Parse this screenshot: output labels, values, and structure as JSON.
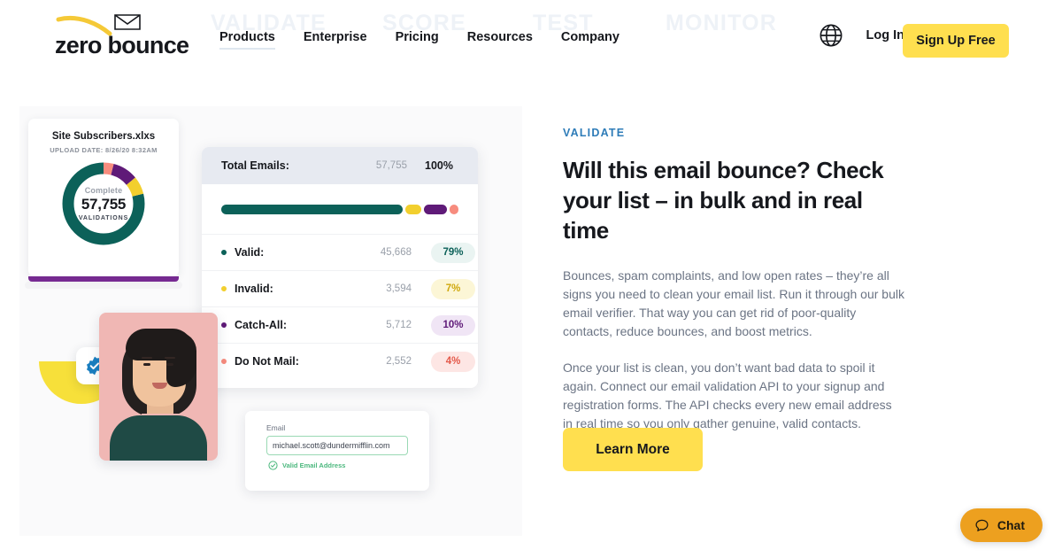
{
  "watermarks": [
    "VALIDATE",
    "SCORE",
    "TEST",
    "MONITOR"
  ],
  "header": {
    "logo_text": "zero bounce",
    "nav": [
      {
        "label": "Products",
        "active": true
      },
      {
        "label": "Enterprise",
        "active": false
      },
      {
        "label": "Pricing",
        "active": false
      },
      {
        "label": "Resources",
        "active": false
      },
      {
        "label": "Company",
        "active": false
      }
    ],
    "language_icon": "globe-icon",
    "login_label": "Log In",
    "signup_label": "Sign Up Free"
  },
  "donut_card": {
    "title": "Site Subscribers.xlxs",
    "subtitle": "UPLOAD DATE: 8/26/20 8:32AM",
    "center_top": "Complete",
    "center_count": "57,755",
    "center_bottom": "VALIDATIONS"
  },
  "stats": {
    "header": {
      "label": "Total Emails:",
      "count": "57,755",
      "percent": "100%"
    },
    "rows": [
      {
        "label": "Valid:",
        "count": "45,668",
        "percent": "79%",
        "color": "#0c6159",
        "pill_bg": "#eaf4f2",
        "pill_fg": "#0c6159"
      },
      {
        "label": "Invalid:",
        "count": "3,594",
        "percent": "7%",
        "color": "#f2cf2e",
        "pill_bg": "#fcf6d6",
        "pill_fg": "#cfa80c"
      },
      {
        "label": "Catch-All:",
        "count": "5,712",
        "percent": "10%",
        "color": "#5f1a78",
        "pill_bg": "#f0e5f5",
        "pill_fg": "#5f1a78"
      },
      {
        "label": "Do Not Mail:",
        "count": "2,552",
        "percent": "4%",
        "color": "#f78c7e",
        "pill_bg": "#fde6e4",
        "pill_fg": "#e4594a"
      }
    ]
  },
  "email_card": {
    "field_label": "Email",
    "value": "michael.scott@dundermifflin.com",
    "status_text": "Valid Email Address",
    "status_icon": "check-circle-icon"
  },
  "badge": {
    "icon": "verified-check-icon",
    "color": "#1a7fc1"
  },
  "copy": {
    "eyebrow": "VALIDATE",
    "headline": "Will this email bounce? Check your list – in bulk and in real time",
    "paragraph_1": "Bounces, spam complaints, and low open rates – they’re all signs you need to clean your email list. Run it through our bulk email verifier. That way you can get rid of poor-quality contacts, reduce bounces, and boost metrics.",
    "paragraph_2": "Once your list is clean, you don’t want bad data to spoil it again. Connect our email validation API to your signup and registration forms. The API checks every new email address in real time so you only gather genuine, valid contacts.",
    "cta_label": "Learn More"
  },
  "chat": {
    "label": "Chat",
    "icon": "chat-bubble-icon",
    "color": "#eda01f"
  },
  "chart_data": {
    "type": "pie",
    "title": "Site Subscribers.xlxs",
    "total": 57755,
    "categories": [
      "Valid",
      "Invalid",
      "Catch-All",
      "Do Not Mail"
    ],
    "values": [
      45668,
      3594,
      5712,
      2552
    ],
    "percents": [
      79,
      7,
      10,
      4
    ],
    "colors": [
      "#0c6159",
      "#f2cf2e",
      "#5f1a78",
      "#f78c7e"
    ],
    "legend": "inline-rows",
    "donut": true
  }
}
